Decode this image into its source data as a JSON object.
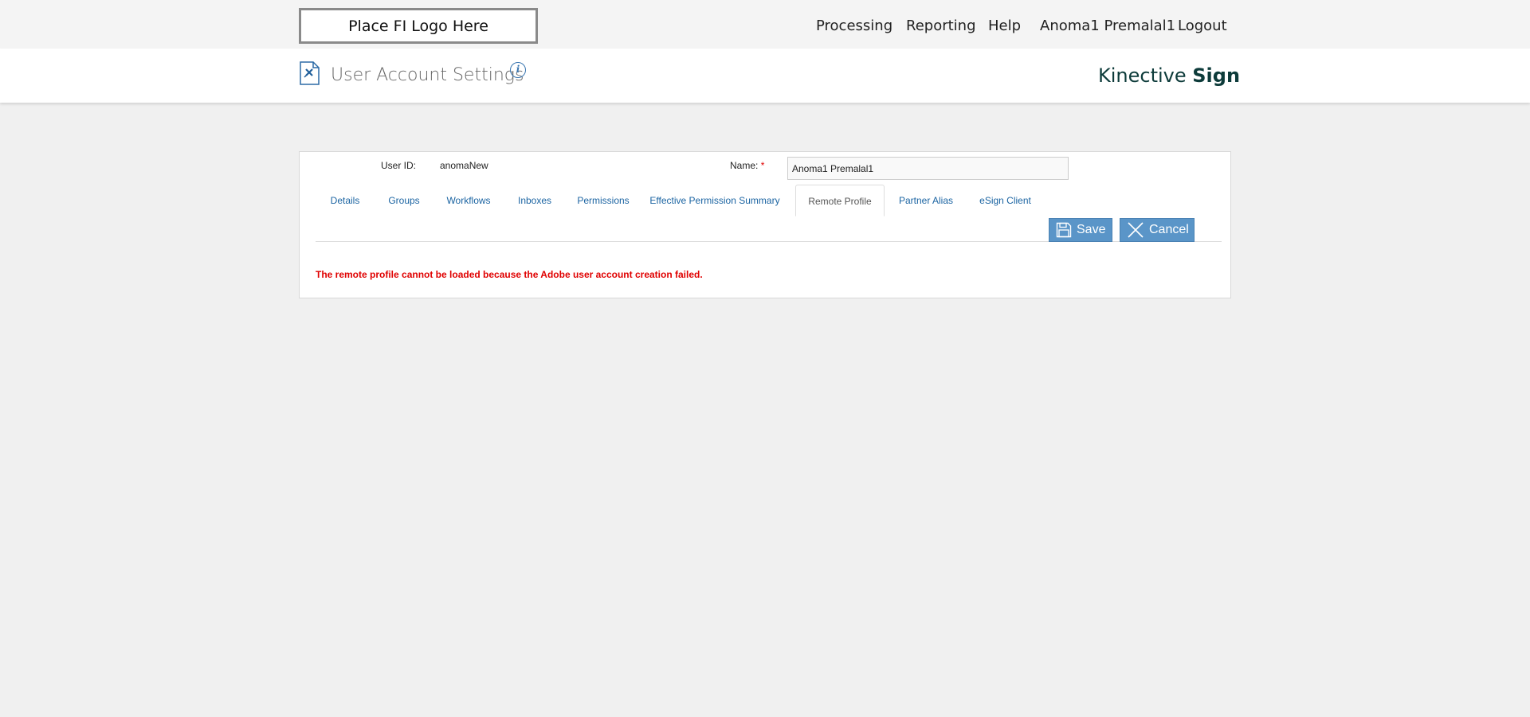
{
  "topbar": {
    "logo_text": "Place FI Logo Here",
    "nav": {
      "processing": "Processing",
      "reporting": "Reporting",
      "help": "Help",
      "user": "Anoma1 Premalal1",
      "logout": "Logout"
    }
  },
  "header": {
    "page_icon": "document-edit-icon",
    "title": "User Account Settings",
    "info_icon_glyph": "i",
    "brand_light": "Kinective ",
    "brand_bold": "Sign"
  },
  "form": {
    "user_id_label": "User ID:",
    "user_id_value": "anomaNew",
    "name_label": "Name:",
    "required_mark": "*",
    "name_value": "Anoma1 Premalal1"
  },
  "tabs": {
    "details": "Details",
    "groups": "Groups",
    "workflows": "Workflows",
    "inboxes": "Inboxes",
    "permissions": "Permissions",
    "effective_permission_summary": "Effective Permission Summary",
    "remote_profile": "Remote Profile",
    "partner_alias": "Partner Alias",
    "esign_client": "eSign Client",
    "active": "Remote Profile"
  },
  "actions": {
    "save_label": "Save",
    "cancel_label": "Cancel"
  },
  "message": {
    "error_text": "The remote profile cannot be loaded because the Adobe user account creation failed."
  },
  "colors": {
    "accent_blue": "#5a95c8",
    "link_blue": "#1b64a2",
    "error_red": "#e00000",
    "brand_dark": "#0d3b3a"
  }
}
